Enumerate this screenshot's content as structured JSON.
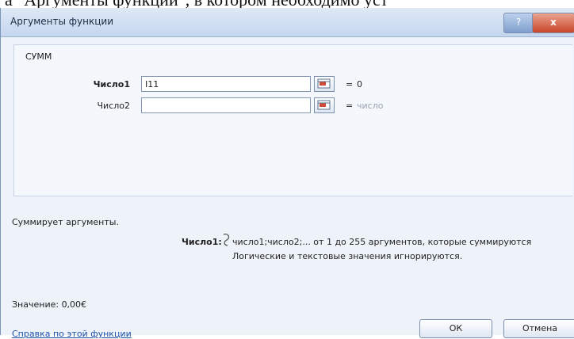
{
  "caption": "а \"Аргументы функции\", в котором необходимо уст",
  "dialog": {
    "title": "Аргументы функции",
    "help_button": "?",
    "close_button": "x"
  },
  "function": {
    "name": "СУММ",
    "args": [
      {
        "label": "Число1",
        "value": "I11",
        "result": "0"
      },
      {
        "label": "Число2",
        "value": "",
        "result": "число"
      }
    ],
    "equals": "="
  },
  "description": "Суммирует аргументы.",
  "arg_help": {
    "name": "Число1:",
    "line1": "число1;число2;... от 1 до 255 аргументов, которые суммируются",
    "line2": "Логические и текстовые значения игнорируются."
  },
  "value": "Значение:  0,00€",
  "help_link": "Справка по этой функции",
  "buttons": {
    "ok": "ОК",
    "cancel": "Отмена"
  }
}
